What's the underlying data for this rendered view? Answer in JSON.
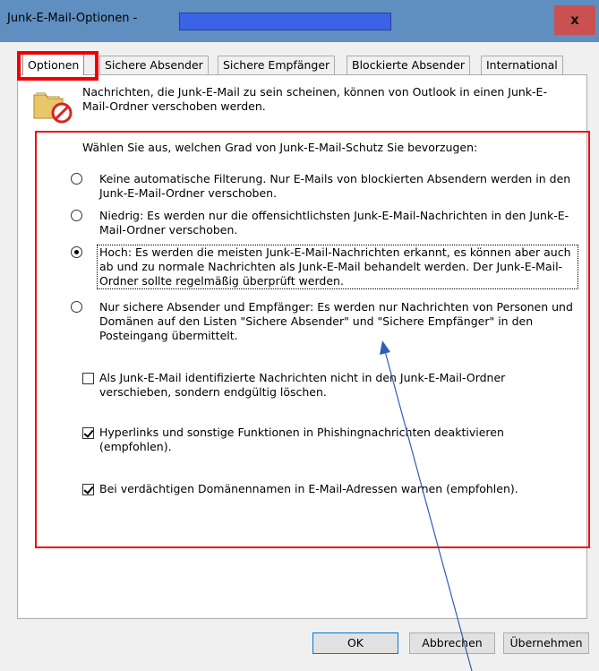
{
  "window": {
    "title": "Junk-E-Mail-Optionen -",
    "close_glyph": "x"
  },
  "tabs": [
    {
      "label": "Optionen",
      "active": true
    },
    {
      "label": "Sichere Absender",
      "active": false
    },
    {
      "label": "Sichere Empfänger",
      "active": false
    },
    {
      "label": "Blockierte Absender",
      "active": false
    },
    {
      "label": "International",
      "active": false
    }
  ],
  "options_panel": {
    "intro": "Nachrichten, die Junk-E-Mail zu sein scheinen, können von Outlook in einen Junk-E-Mail-Ordner verschoben werden.",
    "prompt": "Wählen Sie aus, welchen Grad von Junk-E-Mail-Schutz Sie bevorzugen:",
    "levels": [
      {
        "label": "Keine automatische Filterung. Nur E-Mails von blockierten Absendern werden in den Junk-E-Mail-Ordner verschoben.",
        "selected": false
      },
      {
        "label": "Niedrig: Es werden nur die offensichtlichsten Junk-E-Mail-Nachrichten in den Junk-E-Mail-Ordner verschoben.",
        "selected": false
      },
      {
        "label": "Hoch: Es werden die meisten Junk-E-Mail-Nachrichten erkannt, es können aber auch ab und zu normale Nachrichten als Junk-E-Mail behandelt werden. Der Junk-E-Mail-Ordner sollte regelmäßig überprüft werden.",
        "selected": true
      },
      {
        "label": "Nur sichere Absender und Empfänger: Es werden nur Nachrichten von Personen und Domänen auf den Listen \"Sichere Absender\" und \"Sichere Empfänger\" in den Posteingang übermittelt.",
        "selected": false
      }
    ],
    "checkboxes": [
      {
        "label": "Als Junk-E-Mail identifizierte Nachrichten nicht in den Junk-E-Mail-Ordner verschieben, sondern endgültig löschen.",
        "checked": false
      },
      {
        "label": "Hyperlinks und sonstige Funktionen in Phishingnachrichten deaktivieren (empfohlen).",
        "checked": true
      },
      {
        "label": "Bei verdächtigen Domänennamen in E-Mail-Adressen warnen (empfohlen).",
        "checked": true
      }
    ]
  },
  "buttons": {
    "ok": "OK",
    "cancel": "Abbrechen",
    "apply": "Übernehmen"
  },
  "colors": {
    "titlebar": "#5f8ec0",
    "close_button": "#c95151",
    "highlight": "#f00000",
    "annotation_arrow": "#2f5fb5",
    "redaction": "#3a63e6"
  },
  "icons": {
    "dialog_icon": "junk-folder-icon",
    "close": "close-icon"
  }
}
